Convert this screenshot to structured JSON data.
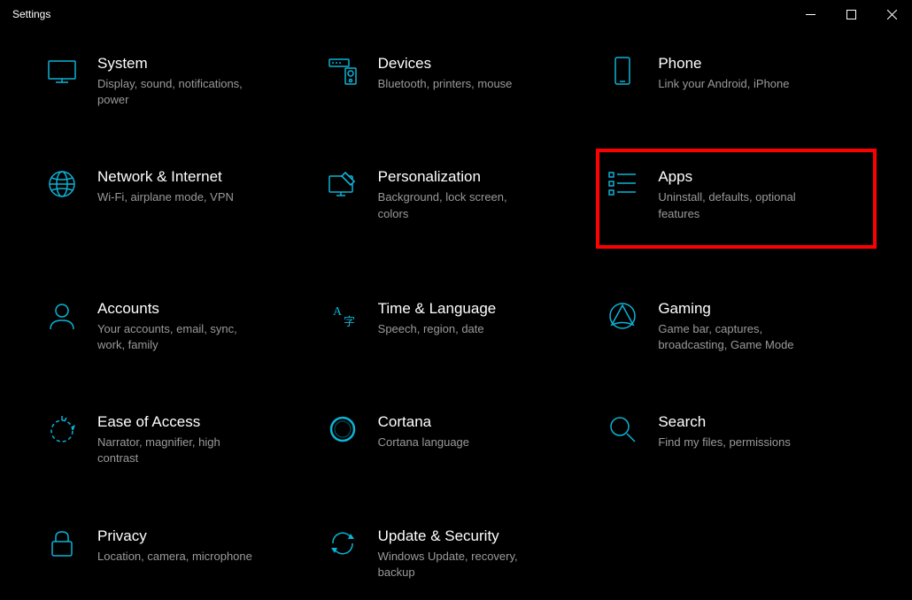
{
  "window": {
    "title": "Settings"
  },
  "tiles": [
    {
      "title": "System",
      "subtitle": "Display, sound, notifications, power"
    },
    {
      "title": "Devices",
      "subtitle": "Bluetooth, printers, mouse"
    },
    {
      "title": "Phone",
      "subtitle": "Link your Android, iPhone"
    },
    {
      "title": "Network & Internet",
      "subtitle": "Wi-Fi, airplane mode, VPN"
    },
    {
      "title": "Personalization",
      "subtitle": "Background, lock screen, colors"
    },
    {
      "title": "Apps",
      "subtitle": "Uninstall, defaults, optional features"
    },
    {
      "title": "Accounts",
      "subtitle": "Your accounts, email, sync, work, family"
    },
    {
      "title": "Time & Language",
      "subtitle": "Speech, region, date"
    },
    {
      "title": "Gaming",
      "subtitle": "Game bar, captures, broadcasting, Game Mode"
    },
    {
      "title": "Ease of Access",
      "subtitle": "Narrator, magnifier, high contrast"
    },
    {
      "title": "Cortana",
      "subtitle": "Cortana language"
    },
    {
      "title": "Search",
      "subtitle": "Find my files, permissions"
    },
    {
      "title": "Privacy",
      "subtitle": "Location, camera, microphone"
    },
    {
      "title": "Update & Security",
      "subtitle": "Windows Update, recovery, backup"
    }
  ]
}
